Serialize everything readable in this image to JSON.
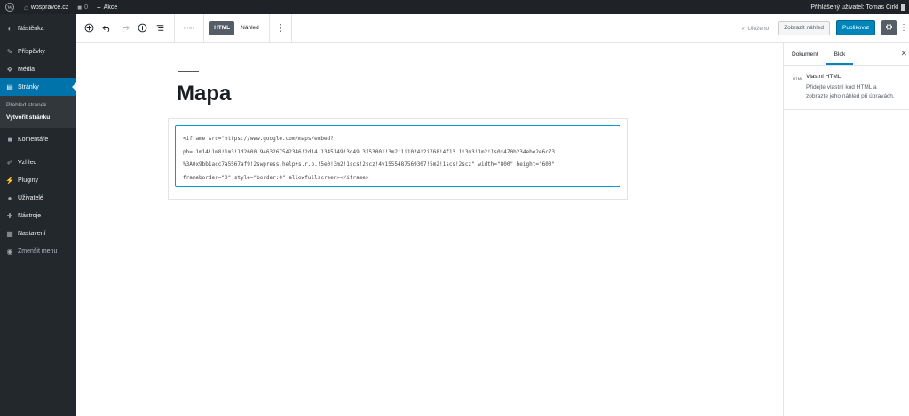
{
  "adminbar": {
    "site_name": "wpspravce.cz",
    "comments_count": "0",
    "new_label": "Akce",
    "user_greeting": "Přihlášený uživatel: Tomas Cirkl"
  },
  "sidebar": {
    "items": [
      {
        "label": "Nástěnka",
        "icon": "dashboard-icon",
        "glyph": "◐"
      },
      {
        "label": "Příspěvky",
        "icon": "pin-icon",
        "glyph": "✎"
      },
      {
        "label": "Média",
        "icon": "media-icon",
        "glyph": "❖"
      },
      {
        "label": "Stránky",
        "icon": "page-icon",
        "glyph": "▤"
      },
      {
        "label": "Komentáře",
        "icon": "comment-icon",
        "glyph": "■"
      },
      {
        "label": "Vzhled",
        "icon": "brush-icon",
        "glyph": "✐"
      },
      {
        "label": "Pluginy",
        "icon": "plugin-icon",
        "glyph": "⚡"
      },
      {
        "label": "Uživatelé",
        "icon": "users-icon",
        "glyph": "●"
      },
      {
        "label": "Nástroje",
        "icon": "tools-icon",
        "glyph": "✚"
      },
      {
        "label": "Nastavení",
        "icon": "settings-icon",
        "glyph": "▦"
      },
      {
        "label": "Zmenšit menu",
        "icon": "collapse-icon",
        "glyph": "◉"
      }
    ],
    "submenu": [
      "Přehled stránek",
      "Vytvořit stránku"
    ]
  },
  "toolbar": {
    "html_small": "HTML",
    "tab_html": "HTML",
    "tab_preview": "Náhled",
    "saved_label": "Uloženo",
    "preview_button": "Zobrazit náhled",
    "publish_button": "Publikovat"
  },
  "editor": {
    "title": "Mapa",
    "code_lines": [
      "<iframe src=\"https://www.google.com/maps/embed?",
      "pb=!1m14!1m8!1m3!1d2600.9463267542346!2d14.1345149!3d49.3153001!3m2!1i1024!2i768!4f13.1!3m3!1m2!1s0x470b234ebe2e6c73",
      "%3A0x9bb1acc7a5567af9!2swpress.help+s.r.o.!5e0!3m2!1scs!2scz!4v1555487569307!5m2!1scs!2scz\" width=\"800\" height=\"600\"",
      "frameborder=\"0\" style=\"border:0\" allowfullscreen></iframe>"
    ]
  },
  "settings_panel": {
    "tab_document": "Dokument",
    "tab_block": "Blok",
    "block_icon_label": "HTML",
    "block_title": "Vlastní HTML",
    "block_description": "Přidejte vlastní kód HTML a zobrazte jeho náhled při úpravách."
  }
}
